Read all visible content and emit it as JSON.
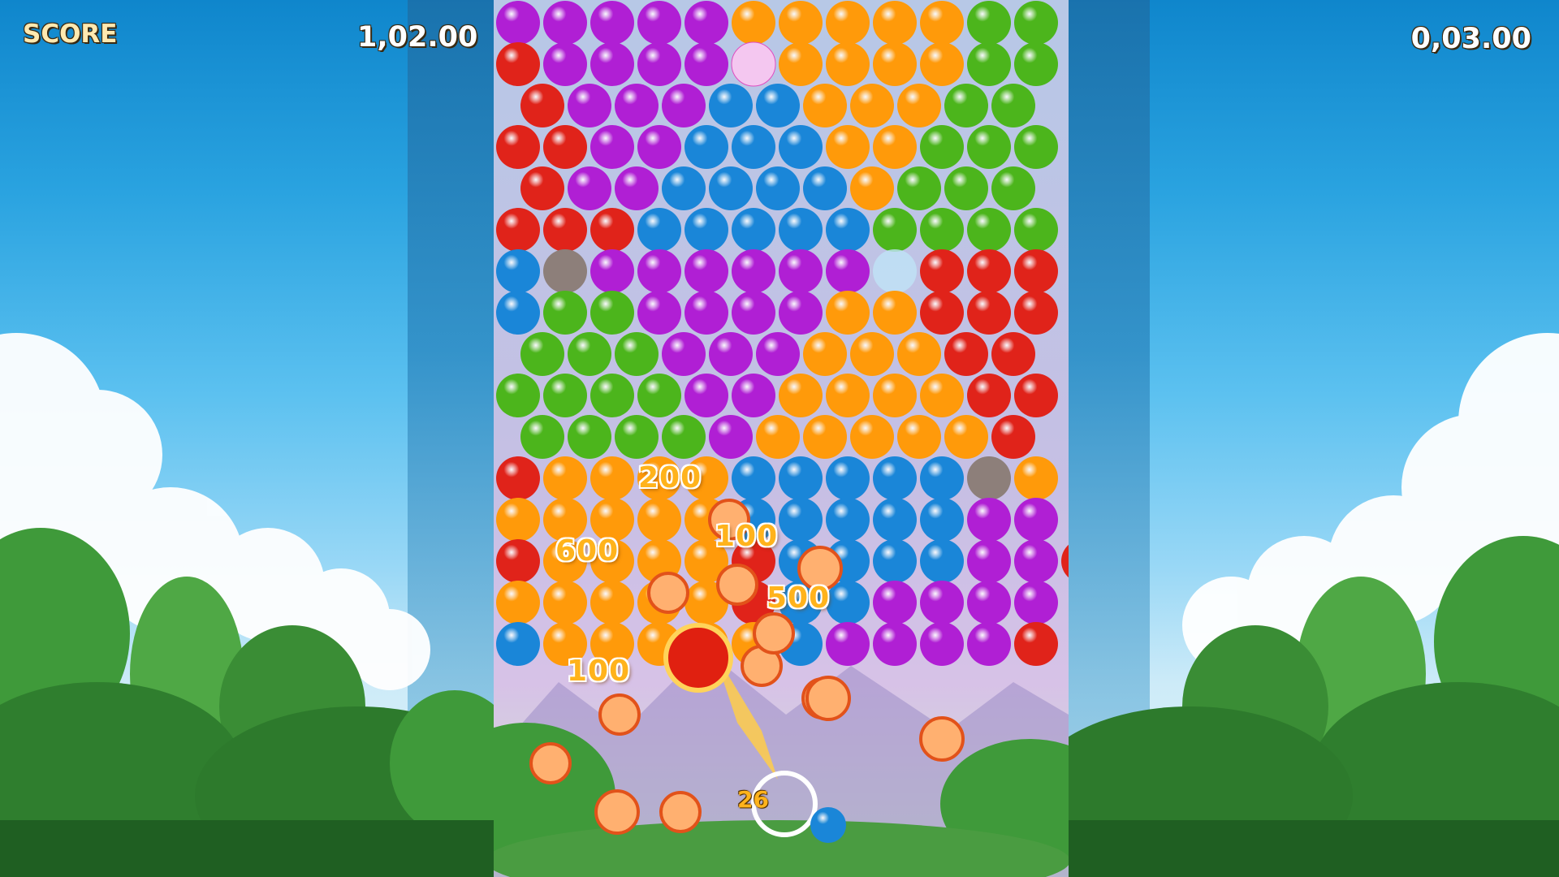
{
  "hud": {
    "score_label": "SCORE",
    "score_left": "1,02.00",
    "score_right": "0,03.00"
  },
  "popups": [
    "200",
    "100",
    "600",
    "500",
    "100"
  ],
  "launcher": {
    "shots_remaining": "26",
    "current_bubble": "fireball",
    "next_bubble": "blue"
  },
  "colors": {
    "red": "#e0231a",
    "orange": "#ff9a0a",
    "purple": "#b01fd4",
    "blue": "#1a86d8",
    "green": "#4cb51c",
    "sky": "#2aa3e0"
  },
  "bubble_rows": [
    "PPPPPOOOOOGG",
    "RPPPPsOOOOGG",
    "RPPPBBOOOGG",
    "RRPPBBBOOGGG",
    "RPPBBBBOGGG",
    "RRRBBBBBGGGG",
    "BrPPPPPPbRRR",
    "BGGPPPPOORRR",
    "GGGPPPOOORR",
    "GGGGPPOOOORR",
    "GGGGPOOOOOR",
    "ROOOOBBBBBrO",
    "OOOOOBBBBBPP",
    "ROOOORBBBBPPR",
    "OOOOORBBPPPP",
    "BOOOOOBPPPPR"
  ]
}
